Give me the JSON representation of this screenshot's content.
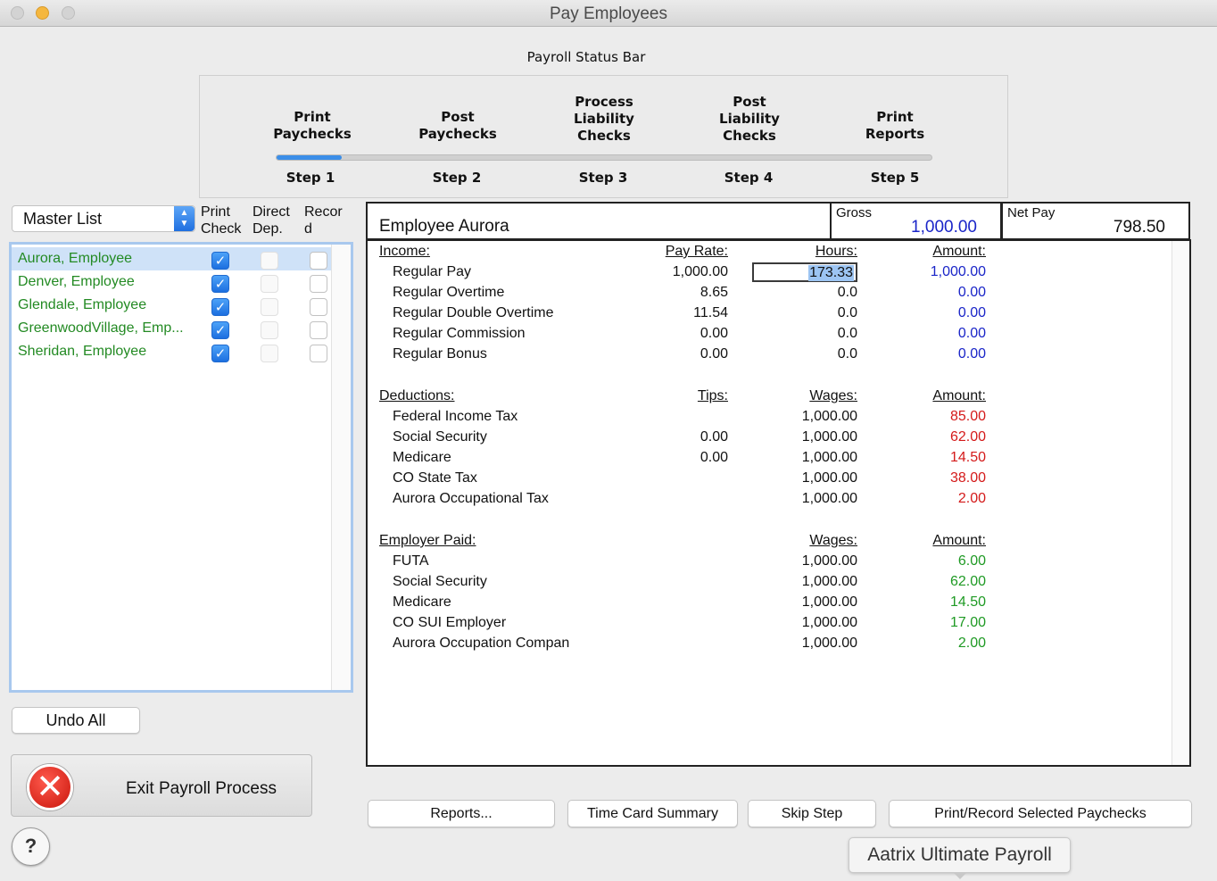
{
  "window": {
    "title": "Pay Employees"
  },
  "status_bar": {
    "caption": "Payroll Status Bar",
    "progress": 0.1,
    "steps": [
      {
        "label_lines": [
          "Print",
          "Paychecks"
        ],
        "step": "Step 1"
      },
      {
        "label_lines": [
          "Post",
          "Paychecks"
        ],
        "step": "Step 2"
      },
      {
        "label_lines": [
          "Process",
          "Liability",
          "Checks"
        ],
        "step": "Step 3"
      },
      {
        "label_lines": [
          "Post",
          "Liability",
          "Checks"
        ],
        "step": "Step 4"
      },
      {
        "label_lines": [
          "Print",
          "Reports"
        ],
        "step": "Step 5"
      }
    ]
  },
  "employee_list": {
    "filter_value": "Master List",
    "columns": [
      {
        "line1": "Print",
        "line2": "Check"
      },
      {
        "line1": "Direct",
        "line2": "Dep."
      },
      {
        "line1": "Recor",
        "line2": "d"
      }
    ],
    "rows": [
      {
        "name": "Aurora, Employee",
        "print_check": true,
        "direct_dep": false,
        "record": false,
        "selected": true
      },
      {
        "name": "Denver, Employee",
        "print_check": true,
        "direct_dep": false,
        "record": false,
        "selected": false
      },
      {
        "name": "Glendale, Employee",
        "print_check": true,
        "direct_dep": false,
        "record": false,
        "selected": false
      },
      {
        "name": "GreenwoodVillage, Emp...",
        "print_check": true,
        "direct_dep": false,
        "record": false,
        "selected": false
      },
      {
        "name": "Sheridan, Employee",
        "print_check": true,
        "direct_dep": false,
        "record": false,
        "selected": false
      }
    ]
  },
  "buttons": {
    "undo_all": "Undo All",
    "exit_payroll": "Exit Payroll Process",
    "help": "?",
    "reports": "Reports...",
    "time_card_summary": "Time Card Summary",
    "skip_step": "Skip Step",
    "print_record": "Print/Record Selected Paychecks"
  },
  "paycheck": {
    "employee_title": "Employee Aurora",
    "gross_label": "Gross",
    "gross_value": "1,000.00",
    "net_label": "Net Pay",
    "net_value": "798.50",
    "income": {
      "headers": {
        "section": "Income:",
        "rate": "Pay Rate:",
        "hours": "Hours:",
        "amount": "Amount:"
      },
      "rows": [
        {
          "name": "Regular Pay",
          "rate": "1,000.00",
          "hours": "173.33",
          "amount": "1,000.00"
        },
        {
          "name": "Regular Overtime",
          "rate": "8.65",
          "hours": "0.0",
          "amount": "0.00"
        },
        {
          "name": "Regular Double Overtime",
          "rate": "11.54",
          "hours": "0.0",
          "amount": "0.00"
        },
        {
          "name": "Regular Commission",
          "rate": "0.00",
          "hours": "0.0",
          "amount": "0.00"
        },
        {
          "name": "Regular Bonus",
          "rate": "0.00",
          "hours": "0.0",
          "amount": "0.00"
        }
      ]
    },
    "deductions": {
      "headers": {
        "section": "Deductions:",
        "tips": "Tips:",
        "wages": "Wages:",
        "amount": "Amount:"
      },
      "rows": [
        {
          "name": "Federal Income Tax",
          "tips": "",
          "wages": "1,000.00",
          "amount": "85.00"
        },
        {
          "name": "Social Security",
          "tips": "0.00",
          "wages": "1,000.00",
          "amount": "62.00"
        },
        {
          "name": "Medicare",
          "tips": "0.00",
          "wages": "1,000.00",
          "amount": "14.50"
        },
        {
          "name": "CO State Tax",
          "tips": "",
          "wages": "1,000.00",
          "amount": "38.00"
        },
        {
          "name": "Aurora Occupational Tax",
          "tips": "",
          "wages": "1,000.00",
          "amount": "2.00"
        }
      ]
    },
    "employer_paid": {
      "headers": {
        "section": "Employer Paid:",
        "wages": "Wages:",
        "amount": "Amount:"
      },
      "rows": [
        {
          "name": "FUTA",
          "wages": "1,000.00",
          "amount": "6.00"
        },
        {
          "name": "Social Security",
          "wages": "1,000.00",
          "amount": "62.00"
        },
        {
          "name": "Medicare",
          "wages": "1,000.00",
          "amount": "14.50"
        },
        {
          "name": "CO SUI Employer",
          "wages": "1,000.00",
          "amount": "17.00"
        },
        {
          "name": "Aurora Occupation Compan",
          "wages": "1,000.00",
          "amount": "2.00"
        }
      ]
    }
  },
  "brand_tab": "Aatrix Ultimate Payroll",
  "colors": {
    "accent": "#3b8ee8",
    "income_amount": "#1a25c8",
    "deduction_amount": "#d41a1a",
    "employer_amount": "#1f9a24",
    "employee_name": "#238a23"
  }
}
